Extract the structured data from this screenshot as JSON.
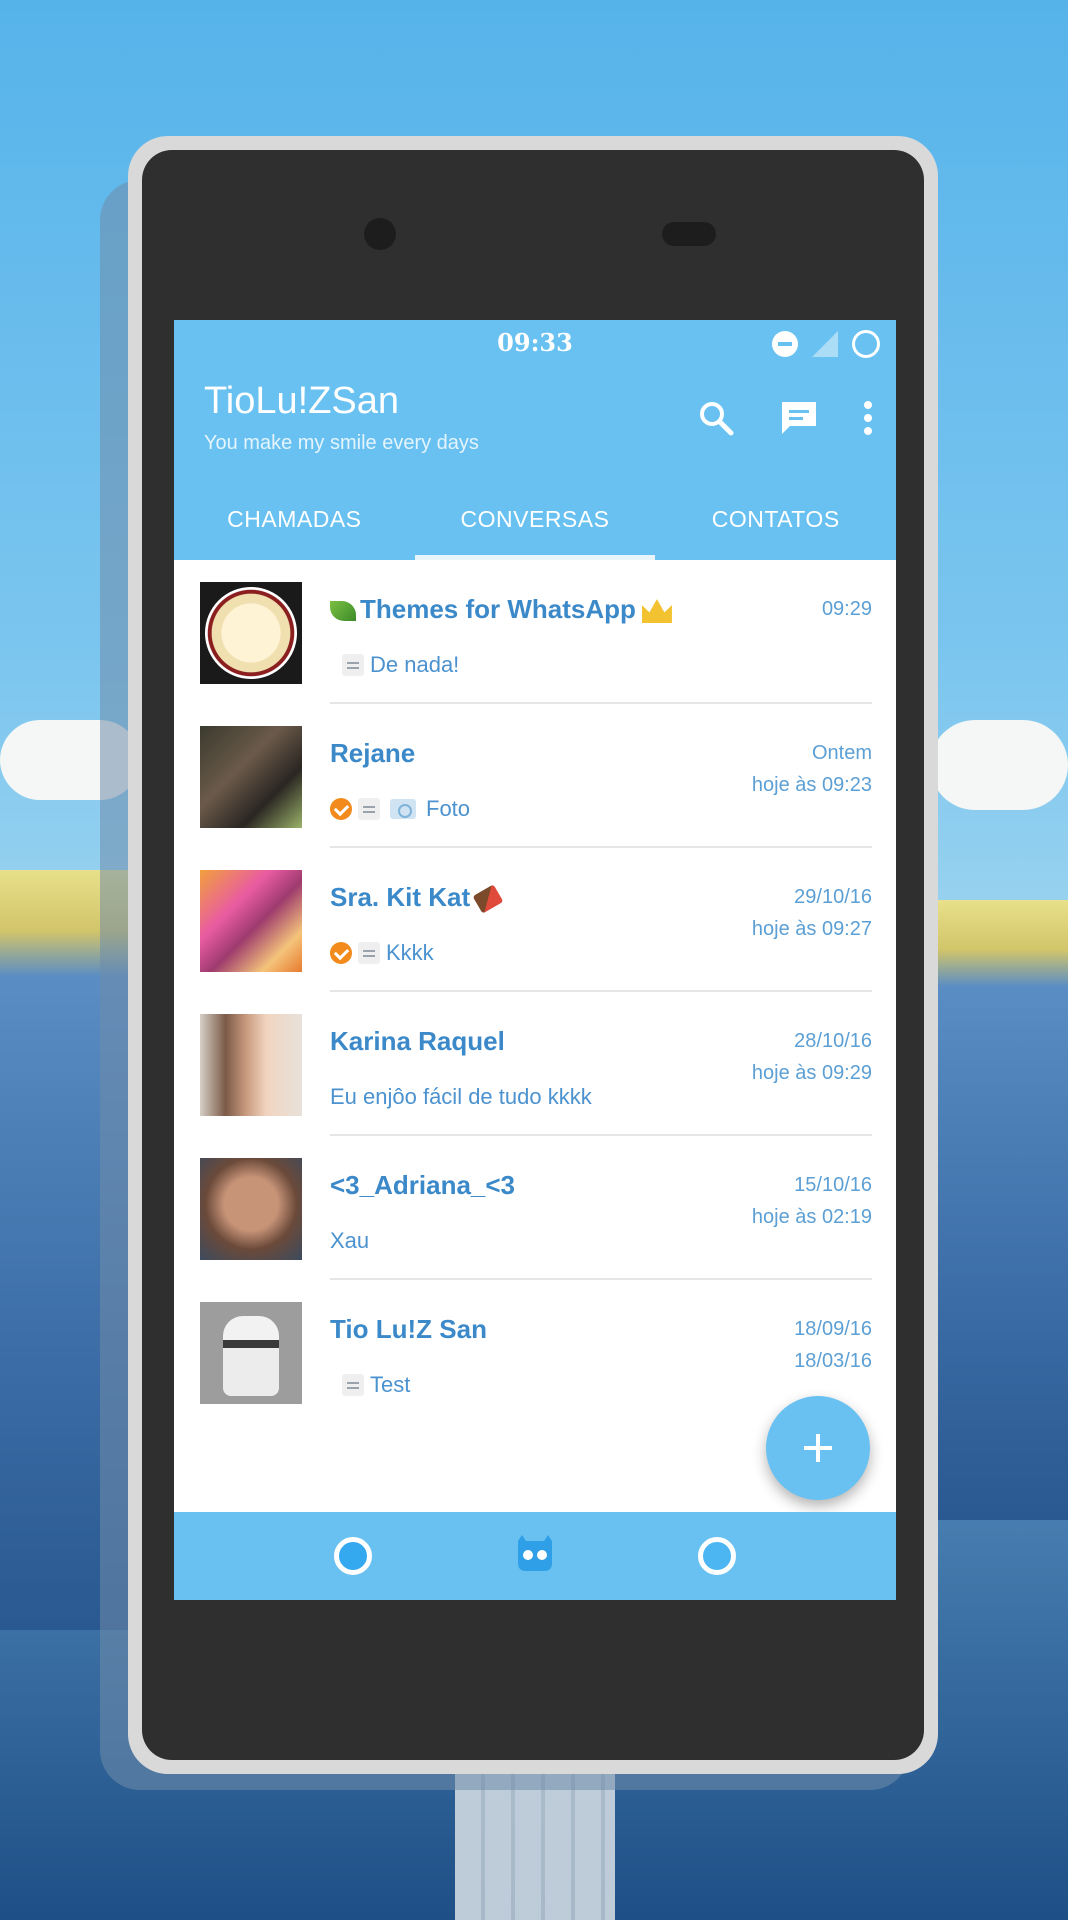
{
  "status_bar": {
    "time": "09:33"
  },
  "header": {
    "title": "TioLu!ZSan",
    "subtitle": "You make my smile every days",
    "actions": [
      "search-icon",
      "new-chat-icon",
      "more-vert-icon"
    ]
  },
  "tabs": [
    {
      "label": "CHAMADAS",
      "active": false
    },
    {
      "label": "CONVERSAS",
      "active": true
    },
    {
      "label": "CONTATOS",
      "active": false
    }
  ],
  "chats": [
    {
      "name": "Themes for WhatsApp",
      "message": "De nada!",
      "date1": "09:29",
      "date2": ""
    },
    {
      "name": "Rejane",
      "message": "Foto",
      "date1": "Ontem",
      "date2": "hoje às 09:23"
    },
    {
      "name": "Sra. Kit Kat",
      "message": "Kkkk",
      "date1": "29/10/16",
      "date2": "hoje às 09:27"
    },
    {
      "name": "Karina Raquel",
      "message": "Eu enjôo fácil de tudo kkkk",
      "date1": "28/10/16",
      "date2": "hoje às 09:29"
    },
    {
      "name": "<3_Adriana_<3",
      "message": "Xau",
      "date1": "15/10/16",
      "date2": "hoje às 02:19"
    },
    {
      "name": "Tio Lu!Z San",
      "message": "Test",
      "date1": "18/09/16",
      "date2": "18/03/16"
    }
  ],
  "fab": {
    "label": "+"
  },
  "colors": {
    "accent": "#68c1f1",
    "name_text": "#3b89c9",
    "tick": "#f28b1c"
  }
}
